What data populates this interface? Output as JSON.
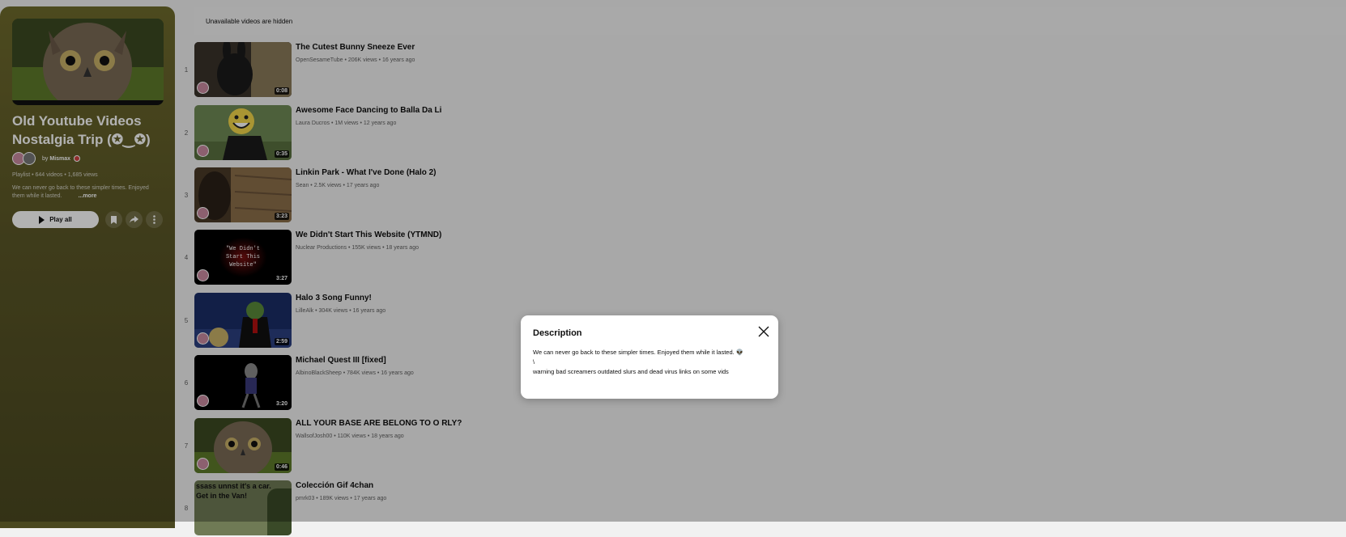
{
  "playlist": {
    "title": "Old Youtube Videos Nostalgia Trip (✪‿✪)",
    "owner_prefix": "by",
    "owner_name": "Mismax",
    "meta": "Playlist • 644 videos • 1,685 views",
    "description_snippet": "We can never go back to these simpler times. Enjoyed them while it lasted.",
    "more_label": "...more",
    "play_all_label": "Play all",
    "accent_color": "#5a5627"
  },
  "banner": {
    "text": "Unavailable videos are hidden"
  },
  "videos": [
    {
      "index": "1",
      "title": "The Cutest Bunny Sneeze Ever",
      "meta": "OpenSesameTube • 206K views • 16 years ago",
      "duration": "0:08"
    },
    {
      "index": "2",
      "title": "Awesome Face Dancing to Balla Da Li",
      "meta": "Laura Ducros • 1M views • 12 years ago",
      "duration": "0:35"
    },
    {
      "index": "3",
      "title": "Linkin Park - What I've Done (Halo 2)",
      "meta": "Sean • 2.5K views • 17 years ago",
      "duration": "3:23"
    },
    {
      "index": "4",
      "title": "We Didn't Start This Website (YTMND)",
      "meta": "Nuclear Productions • 155K views • 18 years ago",
      "duration": "3:27",
      "thumb_text": "\"We Didn't\nStart This\nWebsite\""
    },
    {
      "index": "5",
      "title": "Halo 3 Song Funny!",
      "meta": "LilleAlk • 304K views • 16 years ago",
      "duration": "2:59"
    },
    {
      "index": "6",
      "title": "Michael Quest III [fixed]",
      "meta": "AlbinoBlackSheep • 784K views • 16 years ago",
      "duration": "3:20"
    },
    {
      "index": "7",
      "title": "ALL YOUR BASE ARE BELONG TO O RLY?",
      "meta": "WallsofJosh00 • 110K views • 18 years ago",
      "duration": "0:46"
    },
    {
      "index": "8",
      "title": "Colección Gif 4chan",
      "meta": "pmrk03 • 189K views • 17 years ago",
      "duration": "",
      "thumb_text": "ssass unnst it's a car.\nGet in the Van!"
    }
  ],
  "dialog": {
    "title": "Description",
    "text": "We can never go back to these simpler times. Enjoyed them while it lasted. 👽\n\\\nwarning bad screamers outdated slurs and dead virus links on some vids",
    "close_icon": "close-icon"
  }
}
